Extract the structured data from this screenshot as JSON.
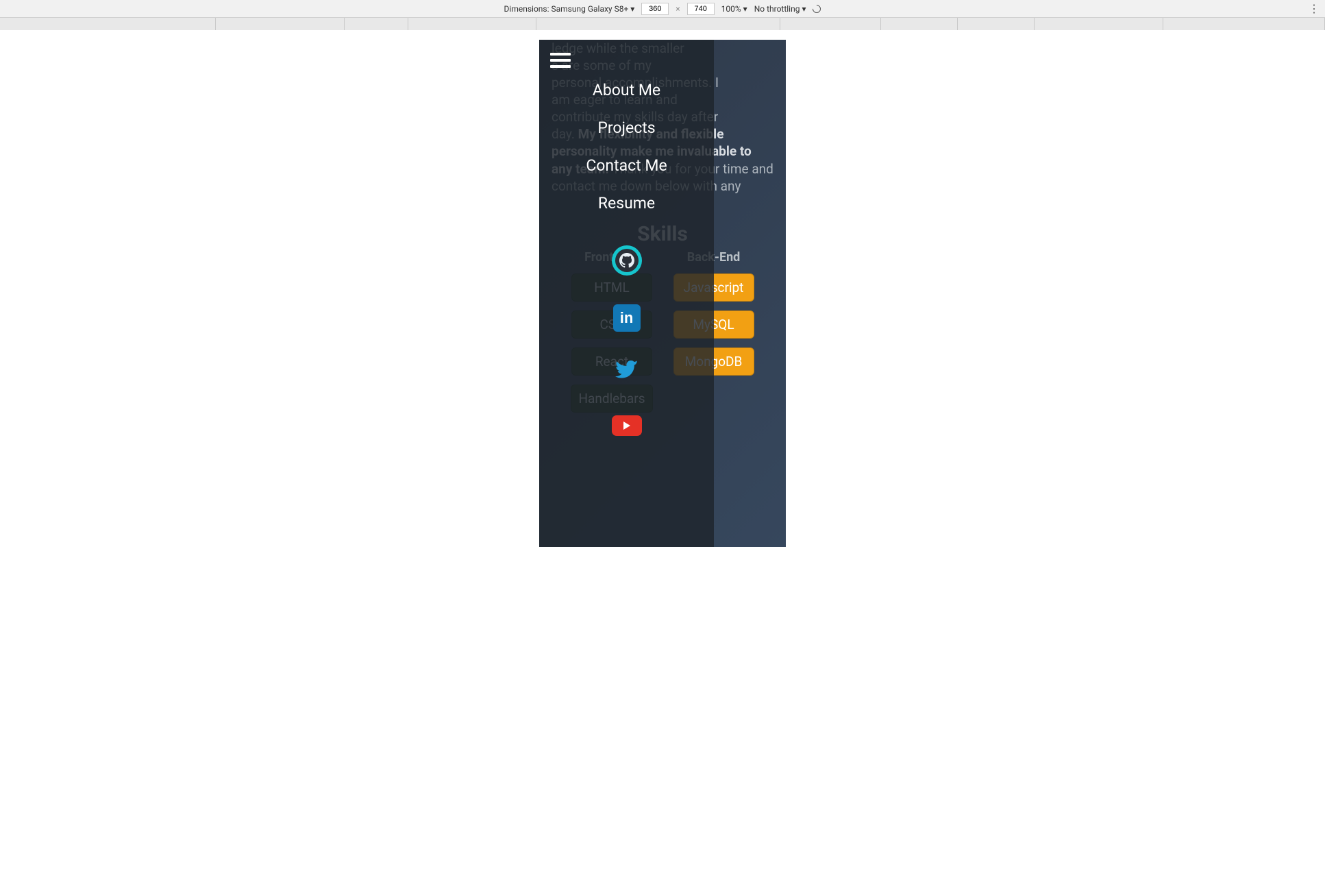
{
  "device_toolbar": {
    "device_label": "Dimensions: Samsung Galaxy S8+ ▾",
    "width": "360",
    "height": "740",
    "multiply": "×",
    "zoom": "100% ▾",
    "throttling": "No throttling ▾"
  },
  "nav": {
    "items": [
      "About Me",
      "Projects",
      "Contact Me",
      "Resume"
    ]
  },
  "socials": {
    "github": "github-icon",
    "linkedin": "in",
    "twitter": "twitter-icon",
    "youtube": "youtube-icon"
  },
  "intro": {
    "line1": "      ledge while the smaller",
    "line2": "      s are some of my",
    "line3": "personal accomplishments. I",
    "line4": "am eager to learn and",
    "line5": "contribute my skills day after",
    "line6_a": "day. ",
    "bold1": "My flexibility and flexible personality make me invaluable to any team.",
    "line7": " Thank you for your time and contact me down below with any"
  },
  "skills": {
    "title": "Skills",
    "front_label": "Front-End",
    "back_label": "Back-End",
    "front": [
      "HTML",
      "CSS",
      "React",
      "Handlebars"
    ],
    "back": [
      "Javascript",
      "MySQL",
      "MongoDB"
    ]
  }
}
